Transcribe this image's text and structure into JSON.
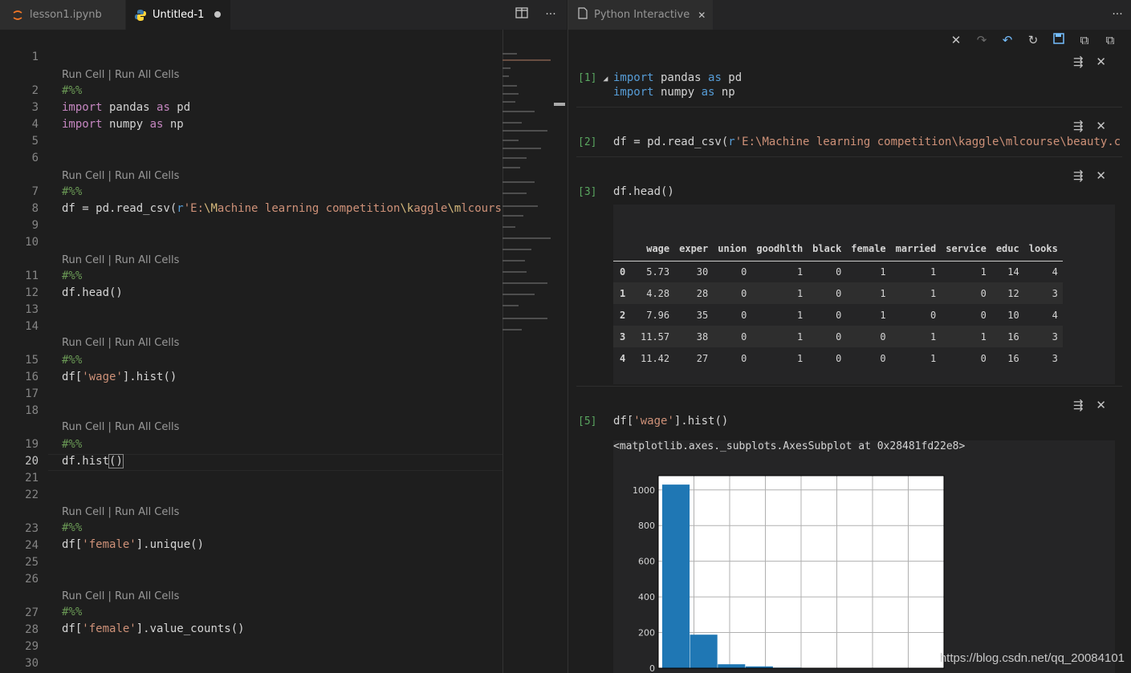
{
  "left_editor": {
    "tabs": [
      {
        "label": "lesson1.ipynb"
      },
      {
        "label": "Untitled-1"
      }
    ],
    "code_lens": "Run Cell | Run All Cells",
    "cell_marker": "#%%",
    "line_numbers": [
      "1",
      "2",
      "3",
      "4",
      "5",
      "6",
      "7",
      "8",
      "9",
      "10",
      "11",
      "12",
      "13",
      "14",
      "15",
      "16",
      "17",
      "18",
      "19",
      "20",
      "21",
      "22",
      "23",
      "24",
      "25",
      "26",
      "27",
      "28",
      "29",
      "30"
    ],
    "current_line": "20",
    "code": {
      "l3_import": "import",
      "l3_mod": " pandas ",
      "l3_as": "as",
      "l3_alias": " pd",
      "l4_import": "import",
      "l4_mod": " numpy ",
      "l4_as": "as",
      "l4_alias": " np",
      "l8_pre": "df = pd.read_csv(",
      "l8_r": "r",
      "l8_s1": "'E:",
      "l8_e1": "\\M",
      "l8_s2": "achine learning competition",
      "l8_e2": "\\k",
      "l8_s3": "aggle",
      "l8_e3": "\\m",
      "l8_s4": "lcourse",
      "l12": "df.head()",
      "l16_pre": "df[",
      "l16_str": "'wage'",
      "l16_post": "].hist()",
      "l20_pre": "df.hist",
      "l20_br": "()",
      "l24_pre": "df[",
      "l24_str": "'female'",
      "l24_post": "].unique()",
      "l28_pre": "df[",
      "l28_str": "'female'",
      "l28_post": "].value_counts()"
    }
  },
  "right_panel": {
    "tab_label": "Python Interactive",
    "cells": [
      {
        "num": "[1]",
        "code1_kw": "import",
        "code1_rest": " pandas ",
        "code1_as": "as",
        "code1_alias": " pd",
        "code2_kw": "import",
        "code2_rest": " numpy ",
        "code2_as": "as",
        "code2_alias": " np"
      },
      {
        "num": "[2]",
        "code_pre": "df = pd.read_csv(",
        "code_r": "r",
        "code_str": "'E:\\Machine learning competition\\kaggle\\mlcourse\\beauty.c"
      },
      {
        "num": "[3]",
        "code": "df.head()"
      },
      {
        "num": "[5]",
        "code_pre": "df[",
        "code_str": "'wage'",
        "code_post": "].hist()"
      }
    ],
    "dataframe": {
      "columns": [
        "",
        "wage",
        "exper",
        "union",
        "goodhlth",
        "black",
        "female",
        "married",
        "service",
        "educ",
        "looks"
      ],
      "rows": [
        [
          "0",
          "5.73",
          "30",
          "0",
          "1",
          "0",
          "1",
          "1",
          "1",
          "14",
          "4"
        ],
        [
          "1",
          "4.28",
          "28",
          "0",
          "1",
          "0",
          "1",
          "1",
          "0",
          "12",
          "3"
        ],
        [
          "2",
          "7.96",
          "35",
          "0",
          "1",
          "0",
          "1",
          "0",
          "0",
          "10",
          "4"
        ],
        [
          "3",
          "11.57",
          "38",
          "0",
          "1",
          "0",
          "0",
          "1",
          "1",
          "16",
          "3"
        ],
        [
          "4",
          "11.42",
          "27",
          "0",
          "1",
          "0",
          "0",
          "1",
          "0",
          "16",
          "3"
        ]
      ]
    },
    "hist_output_text": "<matplotlib.axes._subplots.AxesSubplot at 0x28481fd22e8>"
  },
  "watermark": "https://blog.csdn.net/qq_20084101",
  "chart_data": {
    "type": "bar",
    "title": "",
    "xlabel": "",
    "ylabel": "",
    "yticks": [
      "0",
      "200",
      "400",
      "600",
      "800",
      "1000"
    ],
    "ylim": [
      0,
      1080
    ],
    "values": [
      1030,
      188,
      22,
      10,
      3,
      2,
      1,
      0,
      0,
      0
    ],
    "grid": true,
    "bar_color": "#1f77b4"
  }
}
